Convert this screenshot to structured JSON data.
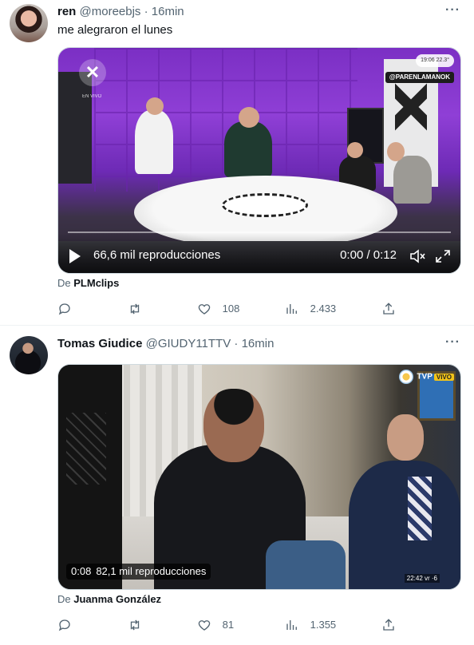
{
  "tweets": [
    {
      "author_name": "ren",
      "author_handle": "@moreebjs",
      "time": "16min",
      "text": "me alegraron el lunes",
      "video": {
        "views": "66,6 mil reproducciones",
        "time": "0:00 / 0:12",
        "overlay_status": "19:06  22.3°",
        "overlay_handle": "@PARENLAMANOK",
        "overlay_live": "EN VIVO"
      },
      "from_prefix": "De",
      "from_source": "PLMclips",
      "stats": {
        "replies": "",
        "retweets": "",
        "likes": "108",
        "views": "2.433"
      }
    },
    {
      "author_name": "Tomas Giudice",
      "author_handle": "@GIUDY11TTV",
      "time": "16min",
      "text": "",
      "video": {
        "elapsed": "0:08",
        "views": "82,1 mil reproducciones",
        "overlay_brand": "TVP",
        "overlay_live": "VIVO",
        "overlay_clock": "22:42 vr ·6"
      },
      "from_prefix": "De",
      "from_source": "Juanma González",
      "stats": {
        "replies": "",
        "retweets": "",
        "likes": "81",
        "views": "1.355"
      }
    }
  ],
  "ui": {
    "separator": "·",
    "more": "···"
  },
  "icons": [
    "reply-icon",
    "retweet-icon",
    "like-icon",
    "views-icon",
    "share-icon",
    "more-icon",
    "play-icon",
    "mute-icon",
    "fullscreen-icon"
  ],
  "colors": {
    "text": "#0f1419",
    "secondary": "#536471",
    "border": "#cfd9de"
  }
}
